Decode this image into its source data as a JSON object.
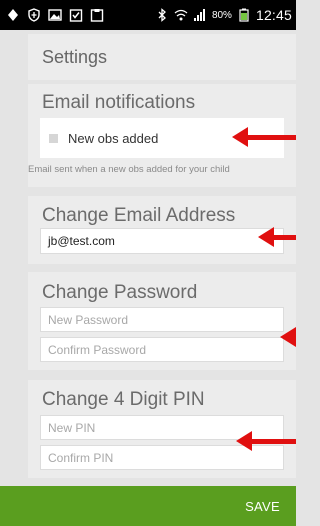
{
  "status_bar": {
    "battery": "80%",
    "time": "12:45"
  },
  "header": {
    "title": "Settings"
  },
  "email_notifications": {
    "title": "Email notifications",
    "checkbox_label": "New obs added",
    "checked": false,
    "helper": "Email sent when a new obs added for your child"
  },
  "change_email": {
    "title": "Change Email Address",
    "value": "jb@test.com"
  },
  "change_password": {
    "title": "Change Password",
    "new_placeholder": "New Password",
    "confirm_placeholder": "Confirm Password"
  },
  "change_pin": {
    "title": "Change 4 Digit PIN",
    "new_placeholder": "New PIN",
    "confirm_placeholder": "Confirm PIN"
  },
  "footer": {
    "save_label": "SAVE",
    "color": "#5a9e1f"
  },
  "annotations": {
    "arrow_color": "#e01010"
  }
}
